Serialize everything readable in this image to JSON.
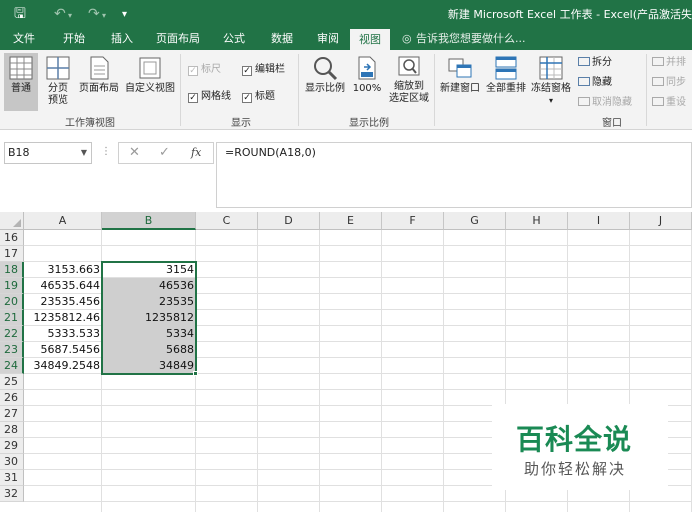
{
  "titlebar": {
    "title": "新建 Microsoft Excel 工作表 - Excel(产品激活失"
  },
  "tabs": [
    {
      "label": "文件"
    },
    {
      "label": "开始"
    },
    {
      "label": "插入"
    },
    {
      "label": "页面布局"
    },
    {
      "label": "公式"
    },
    {
      "label": "数据"
    },
    {
      "label": "审阅"
    },
    {
      "label": "视图"
    }
  ],
  "active_tab": "视图",
  "tellme": "告诉我您想要做什么...",
  "ribbon": {
    "workbook_views": {
      "label": "工作簿视图",
      "normal": "普通",
      "page_break_1": "分页",
      "page_break_2": "预览",
      "page_layout": "页面布局",
      "custom_views": "自定义视图"
    },
    "show": {
      "label": "显示",
      "ruler": "标尺",
      "formula_bar": "编辑栏",
      "gridlines": "网格线",
      "headings": "标题"
    },
    "zoom": {
      "label": "显示比例",
      "zoom": "显示比例",
      "hundred": "100%",
      "zoom_sel_1": "缩放到",
      "zoom_sel_2": "选定区域"
    },
    "window": {
      "label": "窗口",
      "new_window": "新建窗口",
      "arrange_all": "全部重排",
      "freeze_panes": "冻结窗格",
      "split": "拆分",
      "hide": "隐藏",
      "unhide": "取消隐藏",
      "side_by_side": "并排",
      "sync_scroll": "同步",
      "reset_pos": "重设"
    }
  },
  "formula_bar": {
    "name_box": "B18",
    "formula": "=ROUND(A18,0)"
  },
  "columns": [
    "A",
    "B",
    "C",
    "D",
    "E",
    "F",
    "G",
    "H",
    "I",
    "J"
  ],
  "rows": [
    "16",
    "17",
    "18",
    "19",
    "20",
    "21",
    "22",
    "23",
    "24",
    "25",
    "26",
    "27",
    "28",
    "29",
    "30",
    "31",
    "32"
  ],
  "cells": {
    "A18": "3153.663",
    "B18": "3154",
    "A19": "46535.644",
    "B19": "46536",
    "A20": "23535.456",
    "B20": "23535",
    "A21": "1235812.46",
    "B21": "1235812",
    "A22": "5333.533",
    "B22": "5334",
    "A23": "5687.5456",
    "B23": "5688",
    "A24": "34849.2548",
    "B24": "34849"
  },
  "watermark": {
    "title": "百科全说",
    "subtitle": "助你轻松解决"
  }
}
